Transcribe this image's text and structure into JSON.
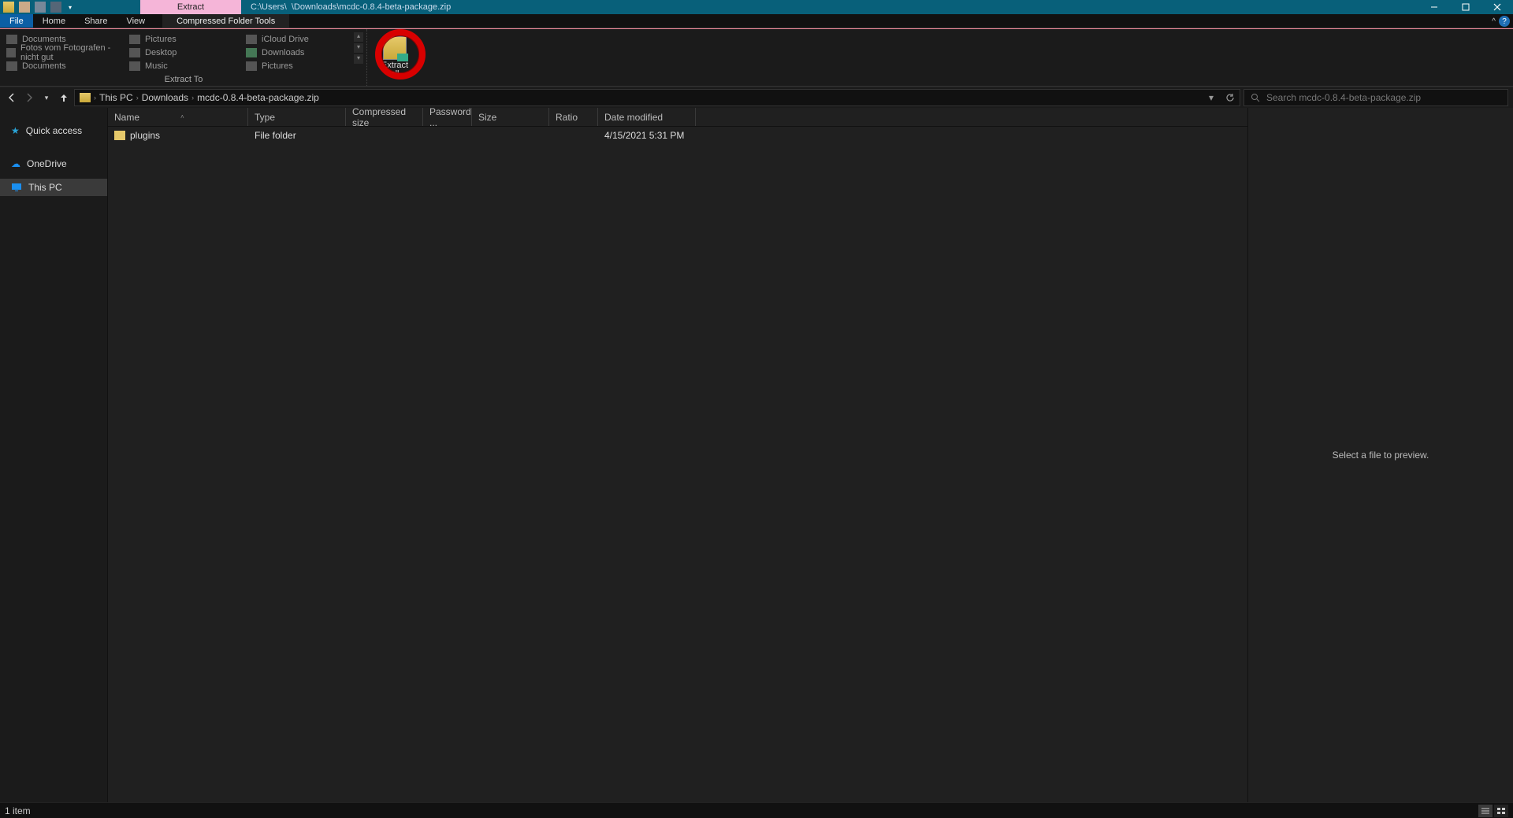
{
  "titlebar": {
    "context_tab": "Extract",
    "path_a": "C:\\Users\\",
    "path_b": "\\Downloads\\mcdc-0.8.4-beta-package.zip"
  },
  "tabs": {
    "file": "File",
    "home": "Home",
    "share": "Share",
    "view": "View",
    "context": "Compressed Folder Tools"
  },
  "ribbon": {
    "pins": {
      "c0r0": "Documents",
      "c0r1": "Fotos vom Fotografen - nicht gut",
      "c0r2": "Documents",
      "c1r0": "Pictures",
      "c1r1": "Desktop",
      "c1r2": "Music",
      "c2r0": "iCloud Drive",
      "c2r1": "Downloads",
      "c2r2": "Pictures"
    },
    "group_label": "Extract To",
    "extract_all_1": "Extract",
    "extract_all_2": "all"
  },
  "breadcrumb": {
    "root": "This PC",
    "a": "Downloads",
    "b": "mcdc-0.8.4-beta-package.zip"
  },
  "search_placeholder": "Search mcdc-0.8.4-beta-package.zip",
  "nav": {
    "quick": "Quick access",
    "onedrive": "OneDrive",
    "thispc": "This PC"
  },
  "columns": {
    "name": "Name",
    "type": "Type",
    "compressed": "Compressed size",
    "password": "Password ...",
    "size": "Size",
    "ratio": "Ratio",
    "date": "Date modified"
  },
  "rows": [
    {
      "name": "plugins",
      "type": "File folder",
      "compressed": "",
      "password": "",
      "size": "",
      "ratio": "",
      "date": "4/15/2021 5:31 PM"
    }
  ],
  "preview_text": "Select a file to preview.",
  "status": {
    "count": "1 item"
  }
}
